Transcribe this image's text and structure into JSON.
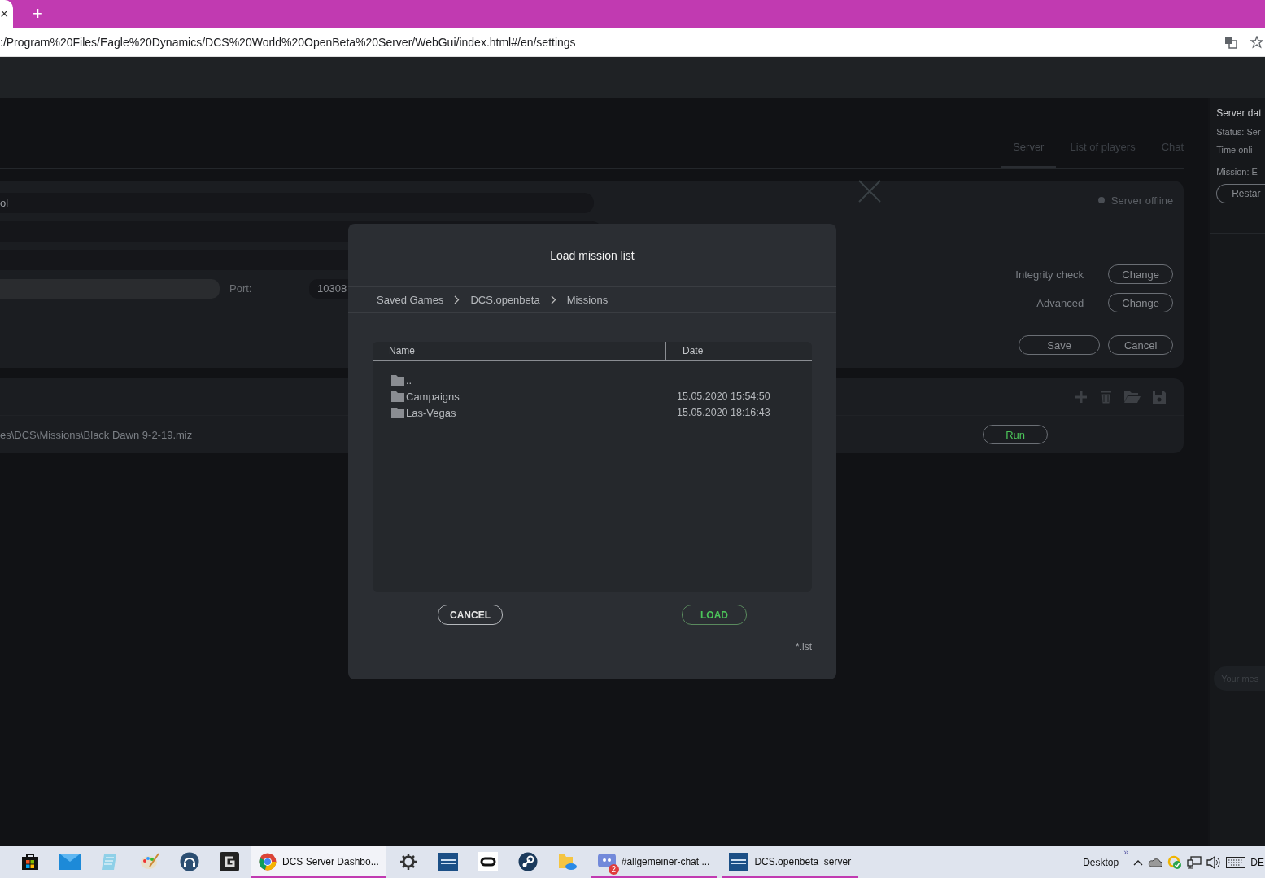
{
  "browser": {
    "tab_close": "×",
    "new_tab": "+",
    "url": ":/Program%20Files/Eagle%20Dynamics/DCS%20World%20OpenBeta%20Server/WebGui/index.html#/en/settings"
  },
  "nav_tabs": [
    {
      "label": "Server",
      "selected": true
    },
    {
      "label": "List of players",
      "selected": false
    },
    {
      "label": "Chat",
      "selected": false
    }
  ],
  "settings": {
    "field_value": "ol",
    "port_label": "Port:",
    "port_value": "10308",
    "status": "Server offline",
    "options": [
      {
        "label": "Integrity check",
        "button": "Change"
      },
      {
        "label": "Advanced",
        "button": "Change"
      }
    ],
    "save": "Save",
    "cancel": "Cancel"
  },
  "missions": {
    "rows": [
      {
        "path": "es\\DCS\\Missions\\Black Dawn 9-2-19.miz",
        "action": "Run"
      }
    ]
  },
  "sidebar": {
    "title": "Server dat",
    "status": "Status: Ser",
    "time": "Time onli",
    "mission": "Mission: E",
    "restart": "Restar",
    "chat_placeholder": "Your mes"
  },
  "dialog": {
    "title": "Load mission list",
    "breadcrumb": [
      "Saved Games",
      "DCS.openbeta",
      "Missions"
    ],
    "columns": [
      "Name",
      "Date"
    ],
    "rows": [
      {
        "name": ".."
      },
      {
        "name": "Campaigns",
        "date": "15.05.2020 15:54:50"
      },
      {
        "name": "Las-Vegas",
        "date": "15.05.2020 18:16:43"
      }
    ],
    "cancel": "CANCEL",
    "load": "LOAD",
    "filter": "*.lst"
  },
  "taskbar": {
    "items": [
      {
        "kind": "store",
        "selected": false
      },
      {
        "kind": "mail",
        "selected": false
      },
      {
        "kind": "notepad",
        "selected": false
      },
      {
        "kind": "paint",
        "selected": false
      },
      {
        "kind": "headset",
        "selected": false
      },
      {
        "kind": "g",
        "selected": false
      },
      {
        "kind": "chrome",
        "label": "DCS Server Dashbo...",
        "selected": true
      },
      {
        "kind": "gear",
        "selected": false
      },
      {
        "kind": "dcs",
        "selected": false
      },
      {
        "kind": "oculus",
        "selected": false
      },
      {
        "kind": "steam",
        "selected": false
      },
      {
        "kind": "folder",
        "selected": false
      },
      {
        "kind": "discord",
        "label": "#allgemeiner-chat ...",
        "badge": "2",
        "selected": false
      },
      {
        "kind": "dcs",
        "label": "DCS.openbeta_server",
        "selected": false
      }
    ],
    "desktop": "Desktop",
    "overflow": "»",
    "language": "DE"
  }
}
